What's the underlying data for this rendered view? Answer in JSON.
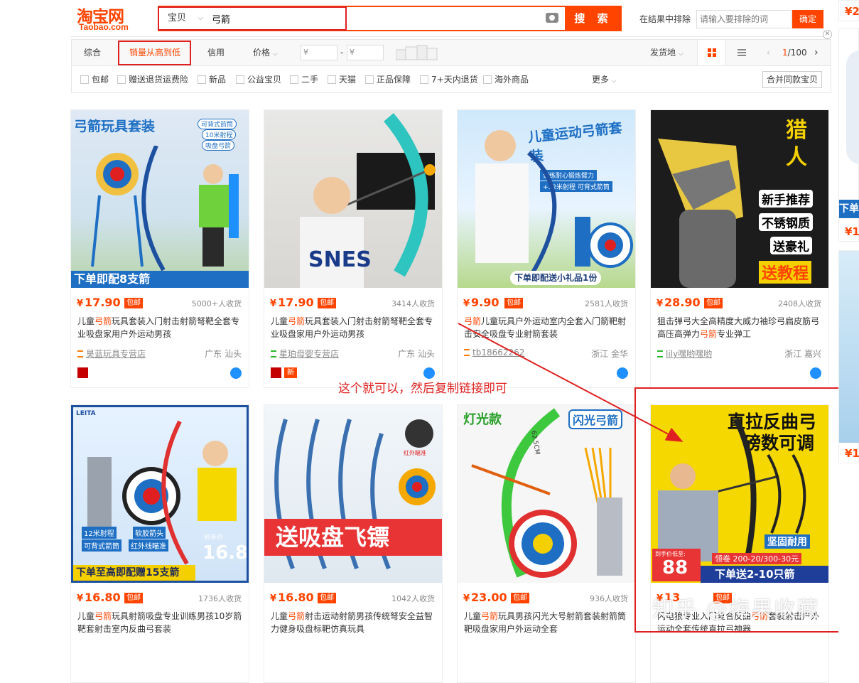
{
  "header": {
    "logo_cn": "淘宝网",
    "logo_en": "Taobao.com",
    "search_category": "宝贝",
    "search_value": "弓箭",
    "search_button": "搜 索",
    "exclude_label": "在结果中排除",
    "exclude_placeholder": "请输入要排除的词",
    "exclude_button": "确定"
  },
  "sortbar": {
    "items": [
      "综合",
      "销量从高到低",
      "信用",
      "价格"
    ],
    "price_min": "¥",
    "price_max": "¥",
    "price_dash": "-",
    "ship_from": "发货地",
    "page": "1",
    "page_total": "/100"
  },
  "filters": [
    "包邮",
    "赠送退货运费险",
    "新品",
    "公益宝贝",
    "二手",
    "天猫",
    "正品保障",
    "7+天内退货",
    "海外商品"
  ],
  "filters_more": "更多",
  "merge_button": "合并同款宝贝",
  "products": [
    {
      "img_text": "弓箭玩具套装",
      "img_sub": [
        "可背式箭筒",
        "10米射程",
        "吸盘弓箭"
      ],
      "img_bottom": "下单即配8支箭",
      "price": "17.90",
      "sales": "5000+人收货",
      "title_pre": "儿童",
      "title_kw": "弓箭",
      "title_post": "玩具套装入门射击射箭弩靶全套专业吸盘家用户外运动男孩",
      "shop": "昊蓝玩具专营店",
      "loc": "广东 汕头"
    },
    {
      "img_text": "",
      "img_sub": [],
      "img_bottom": "",
      "price": "17.90",
      "sales": "3414人收货",
      "title_pre": "儿童",
      "title_kw": "弓箭",
      "title_post": "玩具套装入门射击射箭弩靶全套专业吸盘家用户外运动男孩",
      "shop": "星珀母婴专营店",
      "loc": "广东 汕头"
    },
    {
      "img_text": "儿童运动弓箭套装",
      "img_sub": [
        "训练耐心锻炼臂力",
        "+12米射程 可背式箭筒"
      ],
      "img_bottom": "下单即配送小礼品1份",
      "price": "9.90",
      "sales": "2581人收货",
      "title_pre": "",
      "title_kw": "弓箭",
      "title_post": "儿童玩具户外运动室内全套入门箭靶射击安全吸盘专业射箭套装",
      "shop": "tb18662262",
      "loc": "浙江 金华"
    },
    {
      "img_text": "猎人",
      "img_sub": [
        "新手推荐",
        "不锈钢质",
        "送豪礼",
        "送教程"
      ],
      "img_bottom": "",
      "price": "28.90",
      "sales": "2408人收货",
      "title_pre": "狙击弹弓大全高精度大威力袖珍弓扁皮筋弓高压高弹力",
      "title_kw": "弓箭",
      "title_post": "专业弹工",
      "shop": "lily嘿哟嘿哟",
      "loc": "浙江 嘉兴"
    },
    {
      "img_text": "LEITA",
      "img_sub": [
        "12米射程",
        "软胶箭头",
        "可背式箭筒",
        "红外线瞄准",
        "到手价",
        "16.8"
      ],
      "img_bottom": "下单至高即配赠15支箭",
      "price": "16.80",
      "sales": "1736人收货",
      "title_pre": "儿童",
      "title_kw": "弓箭",
      "title_post": "玩具射箭吸盘专业训练男孩10岁箭靶套射击室内反曲弓套装",
      "shop": "",
      "loc": ""
    },
    {
      "img_text": "送吸盘飞镖",
      "img_sub": [
        "红外瞄准"
      ],
      "img_bottom": "",
      "price": "16.80",
      "sales": "1042人收货",
      "title_pre": "儿童",
      "title_kw": "弓箭",
      "title_post": "射击运动射箭男孩传统弩安全益智力健身吸盘标靶仿真玩具",
      "shop": "",
      "loc": ""
    },
    {
      "img_text": "灯光款",
      "img_sub": [
        "闪光弓箭",
        "62.5CM"
      ],
      "img_bottom": "",
      "price": "23.00",
      "sales": "936人收货",
      "title_pre": "儿童",
      "title_kw": "弓箭",
      "title_post": "玩具男孩闪光大号射箭套装射箭筒靶吸盘家用户外运动全套",
      "shop": "",
      "loc": ""
    },
    {
      "img_text": "直拉反曲弓",
      "img_sub": [
        "磅数可调",
        "坚固耐用",
        "到手价低至:",
        "88",
        "领卷 200-20/300-30元",
        "下单送2-10只箭"
      ],
      "img_bottom": "",
      "price": "13",
      "sales": "",
      "title_pre": "闪电狼专业入门复合反曲",
      "title_kw": "弓箭",
      "title_post": "套装射击户外运动全套传统直拉弓神器",
      "shop": "",
      "loc": ""
    }
  ],
  "badge_baoyou": "包邮",
  "badge_new": "新",
  "annotation": "这个就可以，然后复制链接即可",
  "right_col_prices": [
    "¥2",
    "¥1",
    "¥1"
  ],
  "right_col_text": "下单",
  "watermark": "知乎 @梅果收藏",
  "colors": {
    "accent": "#ff4400",
    "annotation": "#e02020"
  }
}
